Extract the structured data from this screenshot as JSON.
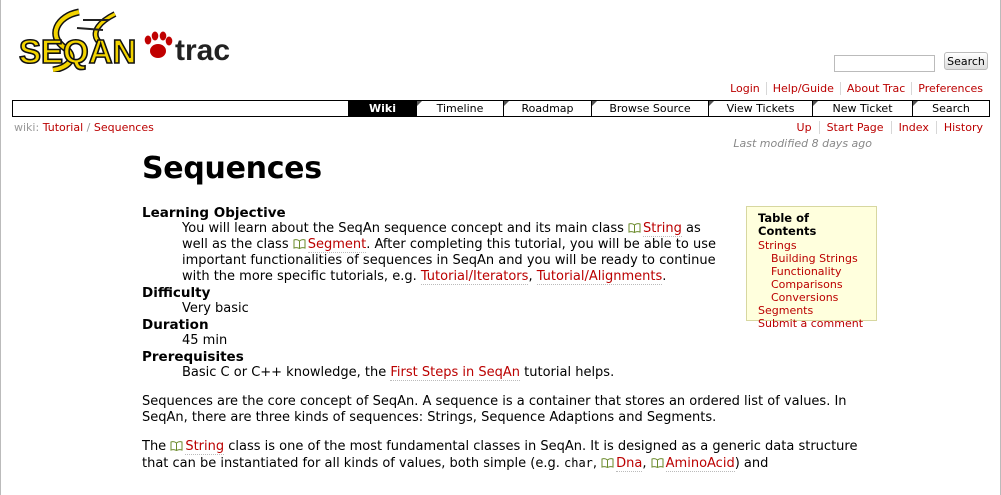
{
  "logo": {
    "brand": "SEQAN",
    "product": "trac"
  },
  "search": {
    "placeholder": "",
    "button": "Search"
  },
  "metanav": [
    "Login",
    "Help/Guide",
    "About Trac",
    "Preferences"
  ],
  "mainnav": [
    {
      "label": "Wiki",
      "active": true
    },
    {
      "label": "Timeline",
      "active": false
    },
    {
      "label": "Roadmap",
      "active": false
    },
    {
      "label": "Browse Source",
      "active": false
    },
    {
      "label": "View Tickets",
      "active": false
    },
    {
      "label": "New Ticket",
      "active": false
    },
    {
      "label": "Search",
      "active": false
    }
  ],
  "breadcrumb": {
    "prefix": "wiki:",
    "part1": "Tutorial",
    "sep": "/",
    "part2": "Sequences"
  },
  "ctxtnav": [
    "Up",
    "Start Page",
    "Index",
    "History"
  ],
  "last_modified": "Last modified 8 days ago",
  "page_title": "Sequences",
  "objective": {
    "label": "Learning Objective",
    "t1": "You will learn about the SeqAn sequence concept and its main class ",
    "link_string": "String",
    "t2": " as well as the class ",
    "link_segment": "Segment",
    "t3": ". After completing this tutorial, you will be able to use important functionalities of sequences in SeqAn and you will be ready to continue with the more specific tutorials, e.g. ",
    "link_iterators": "Tutorial/Iterators",
    "t4": ", ",
    "link_alignments": "Tutorial/Alignments",
    "t5": "."
  },
  "difficulty": {
    "label": "Difficulty",
    "value": "Very basic"
  },
  "duration": {
    "label": "Duration",
    "value": "45 min"
  },
  "prerequisites": {
    "label": "Prerequisites",
    "t1": "Basic C or C++ knowledge, the ",
    "link": "First Steps in SeqAn",
    "t2": " tutorial helps."
  },
  "para1": "Sequences are the core concept of SeqAn. A sequence is a container that stores an ordered list of values. In SeqAn, there are three kinds of sequences: Strings, Sequence Adaptions and Segments.",
  "para2": {
    "t1": "The ",
    "link_string": "String",
    "t2": " class is one of the most fundamental classes in SeqAn. It is designed as a generic data structure that can be instantiated for all kinds of values, both simple (e.g. ",
    "code_char": "char",
    "t3": ", ",
    "link_dna": "Dna",
    "t4": ", ",
    "link_amino": "AminoAcid",
    "t5": ") and"
  },
  "toc": {
    "title": "Table of Contents",
    "items": [
      {
        "label": "Strings",
        "level": 1
      },
      {
        "label": "Building Strings",
        "level": 2
      },
      {
        "label": "Functionality",
        "level": 2
      },
      {
        "label": "Comparisons",
        "level": 2
      },
      {
        "label": "Conversions",
        "level": 2
      },
      {
        "label": "Segments",
        "level": 1
      },
      {
        "label": "Submit a comment",
        "level": 1
      }
    ]
  },
  "colors": {
    "link": "#bb0000",
    "logo_yellow": "#f3d400",
    "logo_red": "#c00000",
    "toc_bg": "#ffffdd"
  }
}
